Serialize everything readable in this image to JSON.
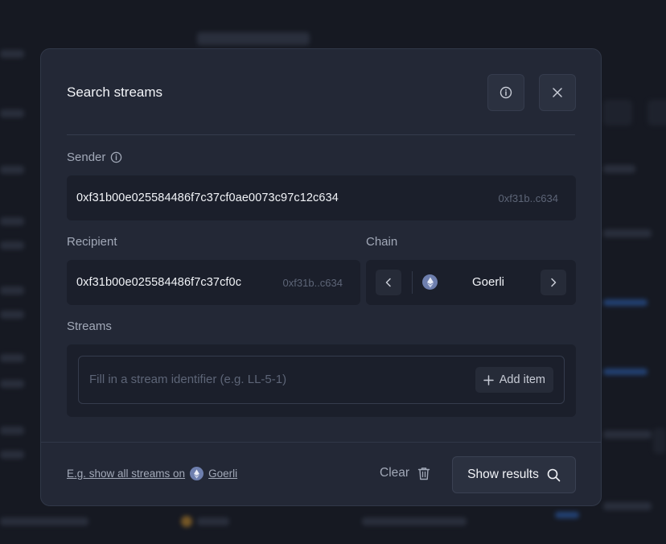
{
  "modal": {
    "title": "Search streams",
    "info_icon": "info-icon",
    "close_icon": "close-icon"
  },
  "sender": {
    "label": "Sender",
    "value": "0xf31b00e025584486f7c37cf0ae0073c97c12c634",
    "short": "0xf31b..c634"
  },
  "recipient": {
    "label": "Recipient",
    "value": "0xf31b00e025584486f7c37cf0c",
    "short": "0xf31b..c634"
  },
  "chain": {
    "label": "Chain",
    "value": "Goerli",
    "icon": "ethereum-icon"
  },
  "streams": {
    "label": "Streams",
    "placeholder": "Fill in a stream identifier (e.g. LL-5-1)",
    "add_label": "Add item"
  },
  "footer": {
    "example_prefix": "E.g. show all streams on",
    "example_chain": "Goerli",
    "clear_label": "Clear",
    "show_results_label": "Show results"
  },
  "colors": {
    "modal_bg": "#232836",
    "field_bg": "#1b1f2b",
    "page_bg": "#161922",
    "accent_blue": "#2e63b8"
  }
}
